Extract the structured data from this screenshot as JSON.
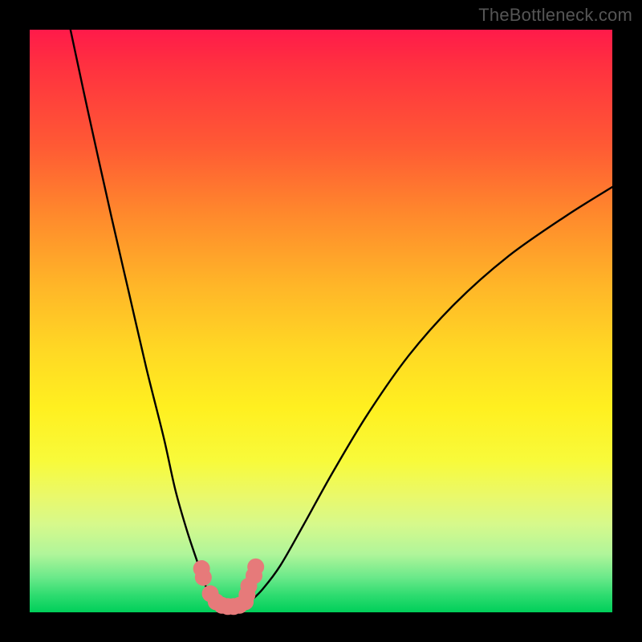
{
  "watermark": "TheBottleneck.com",
  "chart_data": {
    "type": "line",
    "title": "",
    "xlabel": "",
    "ylabel": "",
    "xlim": [
      0,
      100
    ],
    "ylim": [
      0,
      100
    ],
    "grid": false,
    "legend": false,
    "series": [
      {
        "name": "left-curve",
        "stroke": "#000000",
        "x": [
          7,
          10,
          14,
          17,
          20,
          23,
          25,
          27,
          29,
          30,
          31,
          32
        ],
        "y": [
          100,
          86,
          68,
          55,
          42,
          30,
          21,
          14,
          8,
          5,
          3,
          2
        ]
      },
      {
        "name": "right-curve",
        "stroke": "#000000",
        "x": [
          38,
          40,
          43,
          47,
          52,
          58,
          65,
          73,
          82,
          92,
          100
        ],
        "y": [
          2,
          4,
          8,
          15,
          24,
          34,
          44,
          53,
          61,
          68,
          73
        ]
      },
      {
        "name": "bottom-markers",
        "stroke": "#e67a7a",
        "marker": "circle",
        "x": [
          29.5,
          29.8,
          31.0,
          32.0,
          33.0,
          34.0,
          35.0,
          36.0,
          37.0,
          37.3,
          37.6,
          38.5,
          38.8
        ],
        "y": [
          7.5,
          6.0,
          3.2,
          1.8,
          1.2,
          1.0,
          1.0,
          1.2,
          1.8,
          3.0,
          4.5,
          6.3,
          7.8
        ]
      }
    ],
    "gradient_stops": [
      {
        "pct": 0,
        "color": "#ff1a4a"
      },
      {
        "pct": 20,
        "color": "#ff5a34"
      },
      {
        "pct": 44,
        "color": "#ffb628"
      },
      {
        "pct": 65,
        "color": "#fff020"
      },
      {
        "pct": 85,
        "color": "#d6f98c"
      },
      {
        "pct": 100,
        "color": "#00cf5a"
      }
    ]
  }
}
